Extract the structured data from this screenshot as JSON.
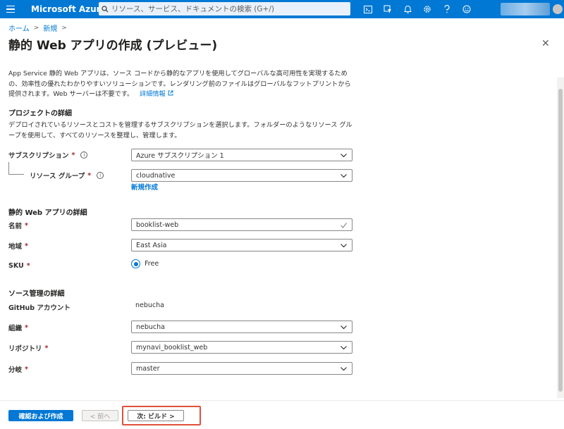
{
  "topbar": {
    "brand": "Microsoft Azure",
    "search_placeholder": "リソース、サービス、ドキュメントの検索 (G+/)",
    "icons": [
      "cloud-shell-icon",
      "directory-filter-icon",
      "bell-icon",
      "gear-icon",
      "help-icon",
      "feedback-icon"
    ]
  },
  "breadcrumb": [
    "ホーム",
    "新規"
  ],
  "title": "静的 Web アプリの作成 (プレビュー)",
  "intro": {
    "text": "App Service 静的 Web アプリは、ソース コードから静的なアプリを使用してグローバルな高可用性を実現するための、効率性の優れたわかりやすいソリューションです。レンダリング前のファイルはグローバルなフットプリントから提供されます。Web サーバーは不要です。",
    "link": "詳細情報"
  },
  "project": {
    "heading": "プロジェクトの詳細",
    "description": "デプロイされているリソースとコストを管理するサブスクリプションを選択します。フォルダーのようなリソース グループを使用して、すべてのリソースを整理し、管理します。",
    "subscription_label": "サブスクリプション",
    "subscription_value": "Azure サブスクリプション 1",
    "rg_label": "リソース グループ",
    "rg_value": "cloudnative",
    "new_link": "新規作成"
  },
  "app": {
    "heading": "静的 Web アプリの詳細",
    "name_label": "名前",
    "name_value": "booklist-web",
    "region_label": "地域",
    "region_value": "East Asia",
    "sku_label": "SKU",
    "sku_value": "Free"
  },
  "source": {
    "heading": "ソース管理の詳細",
    "github_label": "GitHub アカウント",
    "github_value": "nebucha",
    "org_label": "組織",
    "org_value": "nebucha",
    "repo_label": "リポジトリ",
    "repo_value": "mynavi_booklist_web",
    "branch_label": "分岐",
    "branch_value": "master"
  },
  "required_marker": "*",
  "footer": {
    "review_create": "確認および作成",
    "prev": "< 前へ",
    "next": "次: ビルド >"
  },
  "colors": {
    "accent": "#0078d4",
    "highlight": "#e0503a"
  }
}
